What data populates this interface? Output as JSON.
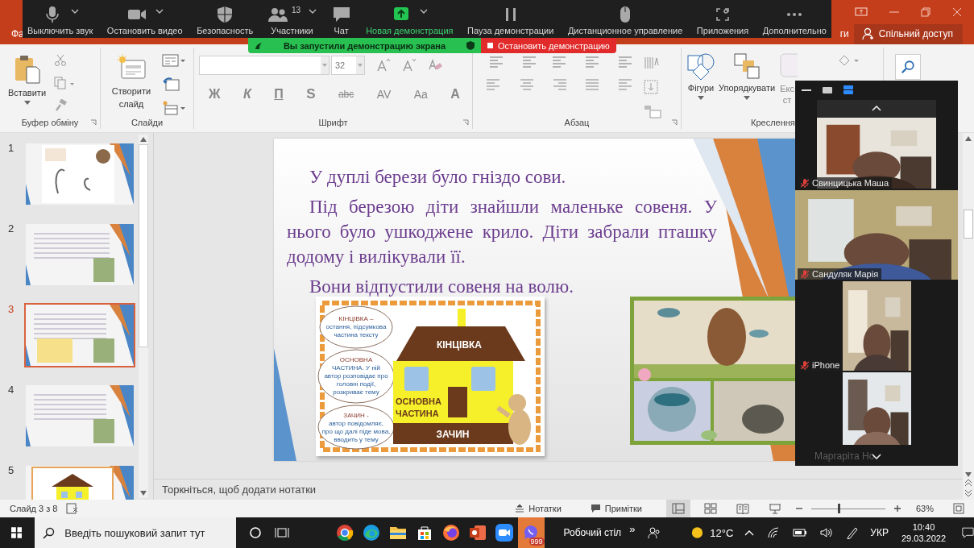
{
  "powerpoint": {
    "ribbon_tabs": [
      {
        "label": "Фа"
      },
      {
        "label": "ги"
      }
    ],
    "share_button": "Спільний доступ",
    "ribbon": {
      "clipboard": {
        "paste": "Вставити",
        "title": "Буфер обміну"
      },
      "slides": {
        "new_slide": "Створити слайд",
        "title": "Слайди"
      },
      "font": {
        "size": "32",
        "buttons": [
          "Ж",
          "К",
          "П",
          "S",
          "abc",
          "AV",
          "Aa",
          "A"
        ],
        "title": "Шрифт"
      },
      "paragraph": {
        "title": "Абзац"
      },
      "drawing": {
        "shapes": "Фігури",
        "arrange": "Упорядкувати",
        "styles_line1": "Екс",
        "styles_line2": "ст",
        "title": "Креслення"
      }
    },
    "thumbnails": [
      {
        "number": "1",
        "selected": false
      },
      {
        "number": "2",
        "selected": false
      },
      {
        "number": "3",
        "selected": true
      },
      {
        "number": "4",
        "selected": false
      },
      {
        "number": "5",
        "selected": false
      }
    ],
    "slide": {
      "paragraphs": [
        "У дуплі берези було гніздо сови.",
        "Під березою діти знайшли маленьке совеня. У нього було ушкоджене крило. Діти забрали пташку додому і вилікували її.",
        "Вони відпустили совеня на волю."
      ],
      "diagram": {
        "roof": "КІНЦІВКА",
        "body": [
          "ОСНОВНА",
          "ЧАСТИНА"
        ],
        "base": "ЗАЧИН",
        "bubbles": [
          [
            "КІНЦІВКА –",
            "остання, підсумкова",
            "частина тексту"
          ],
          [
            "ОСНОВНА",
            "ЧАСТИНА. У ній",
            "автор розповідає про",
            "головні події,",
            "розкриває тему"
          ],
          [
            "ЗАЧИН -",
            "автор повідомляє,",
            "про що далі піде мова,",
            "вводить у тему"
          ]
        ]
      }
    },
    "notes_placeholder": "Торкніться, щоб додати нотатки",
    "status": {
      "slide": "Слайд 3 з 8",
      "notes": "Нотатки",
      "comments": "Примітки",
      "views": [
        {
          "kind": "normal",
          "selected": true
        },
        {
          "kind": "sorter",
          "selected": false
        },
        {
          "kind": "reading",
          "selected": false
        },
        {
          "kind": "show",
          "selected": false
        }
      ],
      "zoom_slider": {
        "level": 0.36
      },
      "zoom": "63%"
    }
  },
  "zoom": {
    "toolbar": [
      {
        "kind": "mic",
        "label": "Выключить звук",
        "menu": true,
        "active": false
      },
      {
        "kind": "video",
        "label": "Остановить видео",
        "menu": true,
        "active": false
      },
      {
        "kind": "shield",
        "label": "Безопасность",
        "menu": false,
        "active": false
      },
      {
        "kind": "people",
        "label": "Участники",
        "count": "13",
        "menu": true,
        "active": false
      },
      {
        "kind": "chat",
        "label": "Чат",
        "menu": false,
        "active": false
      },
      {
        "kind": "share",
        "label": "Новая демонстрация",
        "menu": true,
        "active": true
      },
      {
        "kind": "pause",
        "label": "Пауза демонстрации",
        "menu": false,
        "active": false
      },
      {
        "kind": "mouse",
        "label": "Дистанционное управление",
        "menu": false,
        "active": false
      },
      {
        "kind": "apps",
        "label": "Приложения",
        "menu": false,
        "active": false
      },
      {
        "kind": "more",
        "label": "Дополнительно",
        "menu": false,
        "active": false
      }
    ],
    "sharing_notice": "Вы запустили демонстрацию экрана",
    "stop_button": "Остановить демонстрацию",
    "participants": [
      {
        "name": "Свинцицька Маша",
        "muted": true,
        "kind": "medium"
      },
      {
        "name": "Сандуляк Марія",
        "muted": true,
        "kind": "wide"
      },
      {
        "name": "iPhone",
        "muted": true,
        "kind": "narrow"
      },
      {
        "kind": "narrow-cut"
      }
    ],
    "hidden_name": "Маргаріта Но"
  },
  "taskbar": {
    "search_placeholder": "Введіть пошуковий запит тут",
    "apps": [
      {
        "kind": "chrome"
      },
      {
        "kind": "edge"
      },
      {
        "kind": "folder"
      },
      {
        "kind": "store"
      },
      {
        "kind": "firefox"
      },
      {
        "kind": "powerpoint"
      },
      {
        "kind": "zoom"
      },
      {
        "kind": "viber",
        "badge": "999",
        "selected": true
      }
    ],
    "desktop": "Робочий стіл",
    "chevron": "»",
    "temperature": "12°C",
    "language": "УКР",
    "time": "10:40",
    "date": "29.03.2022"
  }
}
